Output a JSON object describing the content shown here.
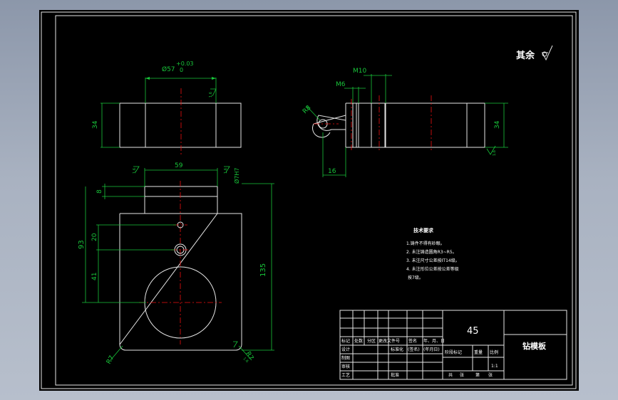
{
  "drawing": {
    "surface_note": "其余",
    "dims": {
      "bore_diameter": "Ø57",
      "tol_upper": "+0.03",
      "tol_lower": "0",
      "height_34_left": "34",
      "height_34_right": "34",
      "m10": "M10",
      "m6": "M6",
      "r8": "R8",
      "d16": "16",
      "w59": "59",
      "fit": "Ø7H7",
      "h8": "8",
      "h93": "93",
      "h20": "20",
      "h41": "41",
      "h135": "135",
      "r7_left": "R7",
      "r7_right": "R7",
      "rough_a": "1.6",
      "rough_b": "1.6",
      "rough_c": "1.6",
      "rough_d": "1.6",
      "rough_e": "1.6"
    },
    "tech_req": {
      "title": "技术要求",
      "items": [
        "1.铸件不得有砂眼。",
        "2. 未注铸造圆角R3~R5。",
        "3. 未注尺寸公差按IT14级。",
        "4. 未注形位公差按公差等级",
        "按7级。"
      ]
    },
    "title_block": {
      "material": "45",
      "part_name": "钻模板",
      "scale": "1:1",
      "labels": {
        "mark": "标记",
        "count": "处数",
        "zone": "分区",
        "doc_no": "更改文件号",
        "sign": "签名",
        "date": "年、月、日",
        "design": "设计",
        "std": "标准化",
        "sign2": "(签名)",
        "date2": "(年月日)",
        "stage_mark": "阶段标记",
        "weight": "重量",
        "ratio": "比例",
        "draw": "制图",
        "check": "审核",
        "craft": "工艺",
        "approve": "批准",
        "total": "共",
        "sheets": "张",
        "page": "第",
        "page_unit": "张"
      }
    }
  }
}
